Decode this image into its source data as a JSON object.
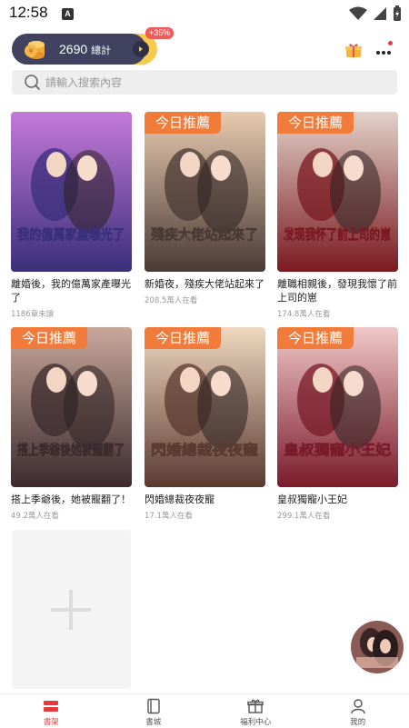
{
  "status": {
    "time": "12:58",
    "indicator": "A"
  },
  "header": {
    "coins": "2690",
    "coins_unit": "總計",
    "bonus_badge": "+35%",
    "icons": [
      "coin-stack-icon",
      "chevron-right-icon",
      "gift-icon",
      "more-icon"
    ],
    "accent": "#f7c94c"
  },
  "search": {
    "placeholder": "請輸入搜索內容"
  },
  "recommend_tag": "今日推薦",
  "books": [
    {
      "title": "離婚後，我的億萬家產曝光了",
      "meta": "1186章未讀",
      "recommended": false,
      "cover_title": "我的億萬家產曝光了",
      "cover_colors": [
        "#3a2f7a",
        "#c57ad8"
      ]
    },
    {
      "title": "新婚夜，殘疾大佬站起來了",
      "meta": "208.5萬人在看",
      "recommended": true,
      "cover_title": "殘疾大佬站起來了",
      "cover_colors": [
        "#4a3a35",
        "#e8cbb0"
      ]
    },
    {
      "title": "離職相親後，發現我懷了前上司的崽",
      "meta": "174.8萬人在看",
      "recommended": true,
      "cover_title": "发现我怀了前上司的崽",
      "cover_colors": [
        "#7a1a20",
        "#e2d2c8"
      ]
    },
    {
      "title": "搭上季爺後，她被寵翻了！",
      "meta": "49.2萬人在看",
      "recommended": true,
      "cover_title": "搭上季爺後她被寵翻了",
      "cover_colors": [
        "#3b2a2e",
        "#c9a89a"
      ]
    },
    {
      "title": "閃婚總裁夜夜寵",
      "meta": "17.1萬人在看",
      "recommended": true,
      "cover_title": "閃婚總裁夜夜寵",
      "cover_colors": [
        "#5a3a30",
        "#efd8c0"
      ]
    },
    {
      "title": "皇叔獨寵小王妃",
      "meta": "299.1萬人在看",
      "recommended": true,
      "cover_title": "皇叔獨寵小王妃",
      "cover_colors": [
        "#7a1b2a",
        "#f0c8c8"
      ]
    }
  ],
  "tabs": [
    {
      "label": "書架",
      "icon": "bookshelf-icon",
      "active": true
    },
    {
      "label": "書城",
      "icon": "book-icon",
      "active": false
    },
    {
      "label": "福利中心",
      "icon": "gift-icon",
      "active": false
    },
    {
      "label": "我的",
      "icon": "user-icon",
      "active": false
    }
  ],
  "colors": {
    "accent_red": "#e53a3a",
    "tag_orange": "#f07b3a"
  }
}
